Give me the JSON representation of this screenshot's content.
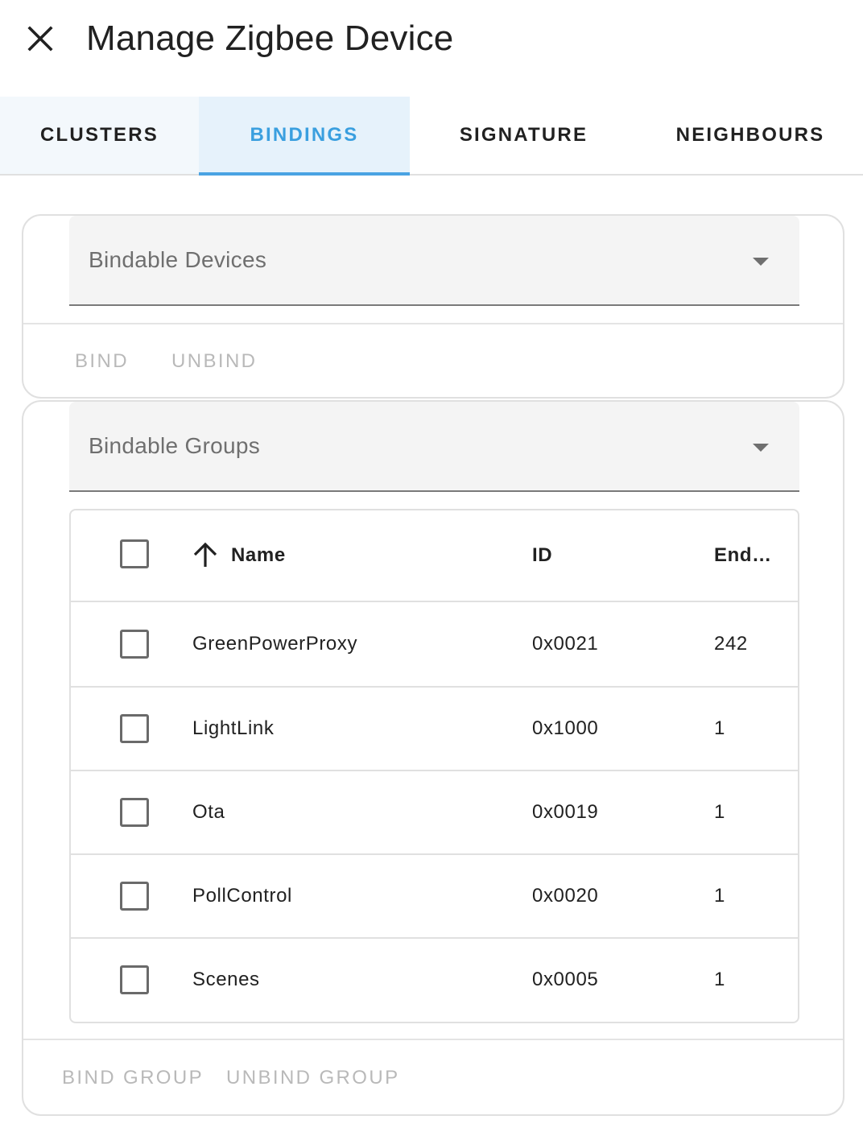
{
  "dialog": {
    "title": "Manage Zigbee Device"
  },
  "tabs": [
    {
      "label": "CLUSTERS",
      "active": false
    },
    {
      "label": "BINDINGS",
      "active": true
    },
    {
      "label": "SIGNATURE",
      "active": false
    },
    {
      "label": "NEIGHBOURS",
      "active": false
    }
  ],
  "devices_card": {
    "select_label": "Bindable Devices",
    "bind_label": "BIND",
    "unbind_label": "UNBIND"
  },
  "groups_card": {
    "select_label": "Bindable Groups",
    "bind_group_label": "BIND GROUP",
    "unbind_group_label": "UNBIND GROUP",
    "table": {
      "columns": [
        "Name",
        "ID",
        "End…"
      ],
      "sort": {
        "column": "Name",
        "direction": "ascending"
      },
      "rows": [
        {
          "name": "GreenPowerProxy",
          "id": "0x0021",
          "endpoint": "242",
          "checked": false
        },
        {
          "name": "LightLink",
          "id": "0x1000",
          "endpoint": "1",
          "checked": false
        },
        {
          "name": "Ota",
          "id": "0x0019",
          "endpoint": "1",
          "checked": false
        },
        {
          "name": "PollControl",
          "id": "0x0020",
          "endpoint": "1",
          "checked": false
        },
        {
          "name": "Scenes",
          "id": "0x0005",
          "endpoint": "1",
          "checked": false
        }
      ]
    }
  },
  "icons": {
    "close": "close-icon",
    "dropdown": "chevron-down-icon",
    "sort": "arrow-up-icon"
  },
  "colors": {
    "accent": "#3a9fdf",
    "active_tab_bg": "#e6f2fb",
    "disabled_text": "#b9b9b9"
  }
}
